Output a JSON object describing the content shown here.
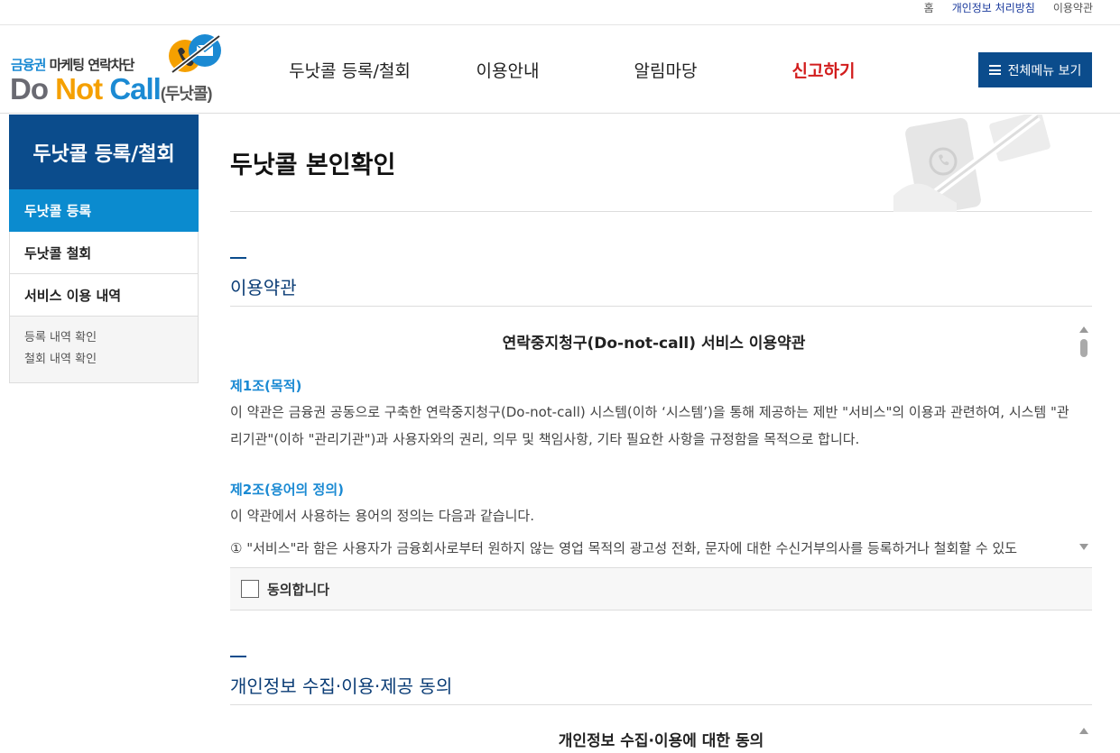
{
  "top_links": [
    "홈",
    "개인정보 처리방침",
    "이용약관"
  ],
  "logo": {
    "sub_blue": "금융권",
    "sub_dark": "마케팅 연락차단",
    "main_do": "Do",
    "main_not": "Not",
    "main_call": "Call",
    "main_korean": "(두낫콜)"
  },
  "nav": [
    "두낫콜 등록/철회",
    "이용안내",
    "알림마당",
    "신고하기"
  ],
  "menu_button": "전체메뉴 보기",
  "sidebar": {
    "title": "두낫콜 등록/철회",
    "items": [
      "두낫콜 등록",
      "두낫콜 철회",
      "서비스 이용 내역"
    ],
    "sub_items": [
      "등록 내역 확인",
      "철회 내역 확인"
    ]
  },
  "page_title": "두낫콜 본인확인",
  "terms": {
    "section_title": "이용약관",
    "doc_title": "연락중지청구(Do-not-call) 서비스 이용약관",
    "article1_head": "제1조(목적)",
    "article1_body": "이 약관은 금융권 공동으로 구축한 연락중지청구(Do-not-call) 시스템(이하 ‘시스템’)을 통해 제공하는 제반 \"서비스\"의 이용과 관련하여, 시스템 \"관리기관\"(이하 \"관리기관\")과 사용자와의 권리, 의무 및 책임사항, 기타 필요한 사항을 규정함을 목적으로 합니다.",
    "article2_head": "제2조(용어의 정의)",
    "article2_body": "이 약관에서 사용하는 용어의 정의는 다음과 같습니다.",
    "article2_item1": "① \"서비스\"라 함은 사용자가 금융회사로부터 원하지 않는 영업 목적의 광고성 전화, 문자에 대한 수신거부의사를 등록하거나 철회할 수 있도",
    "agree_label": "동의합니다"
  },
  "privacy": {
    "section_title": "개인정보 수집·이용·제공 동의",
    "doc_title": "개인정보 수집·이용에 대한 동의"
  }
}
